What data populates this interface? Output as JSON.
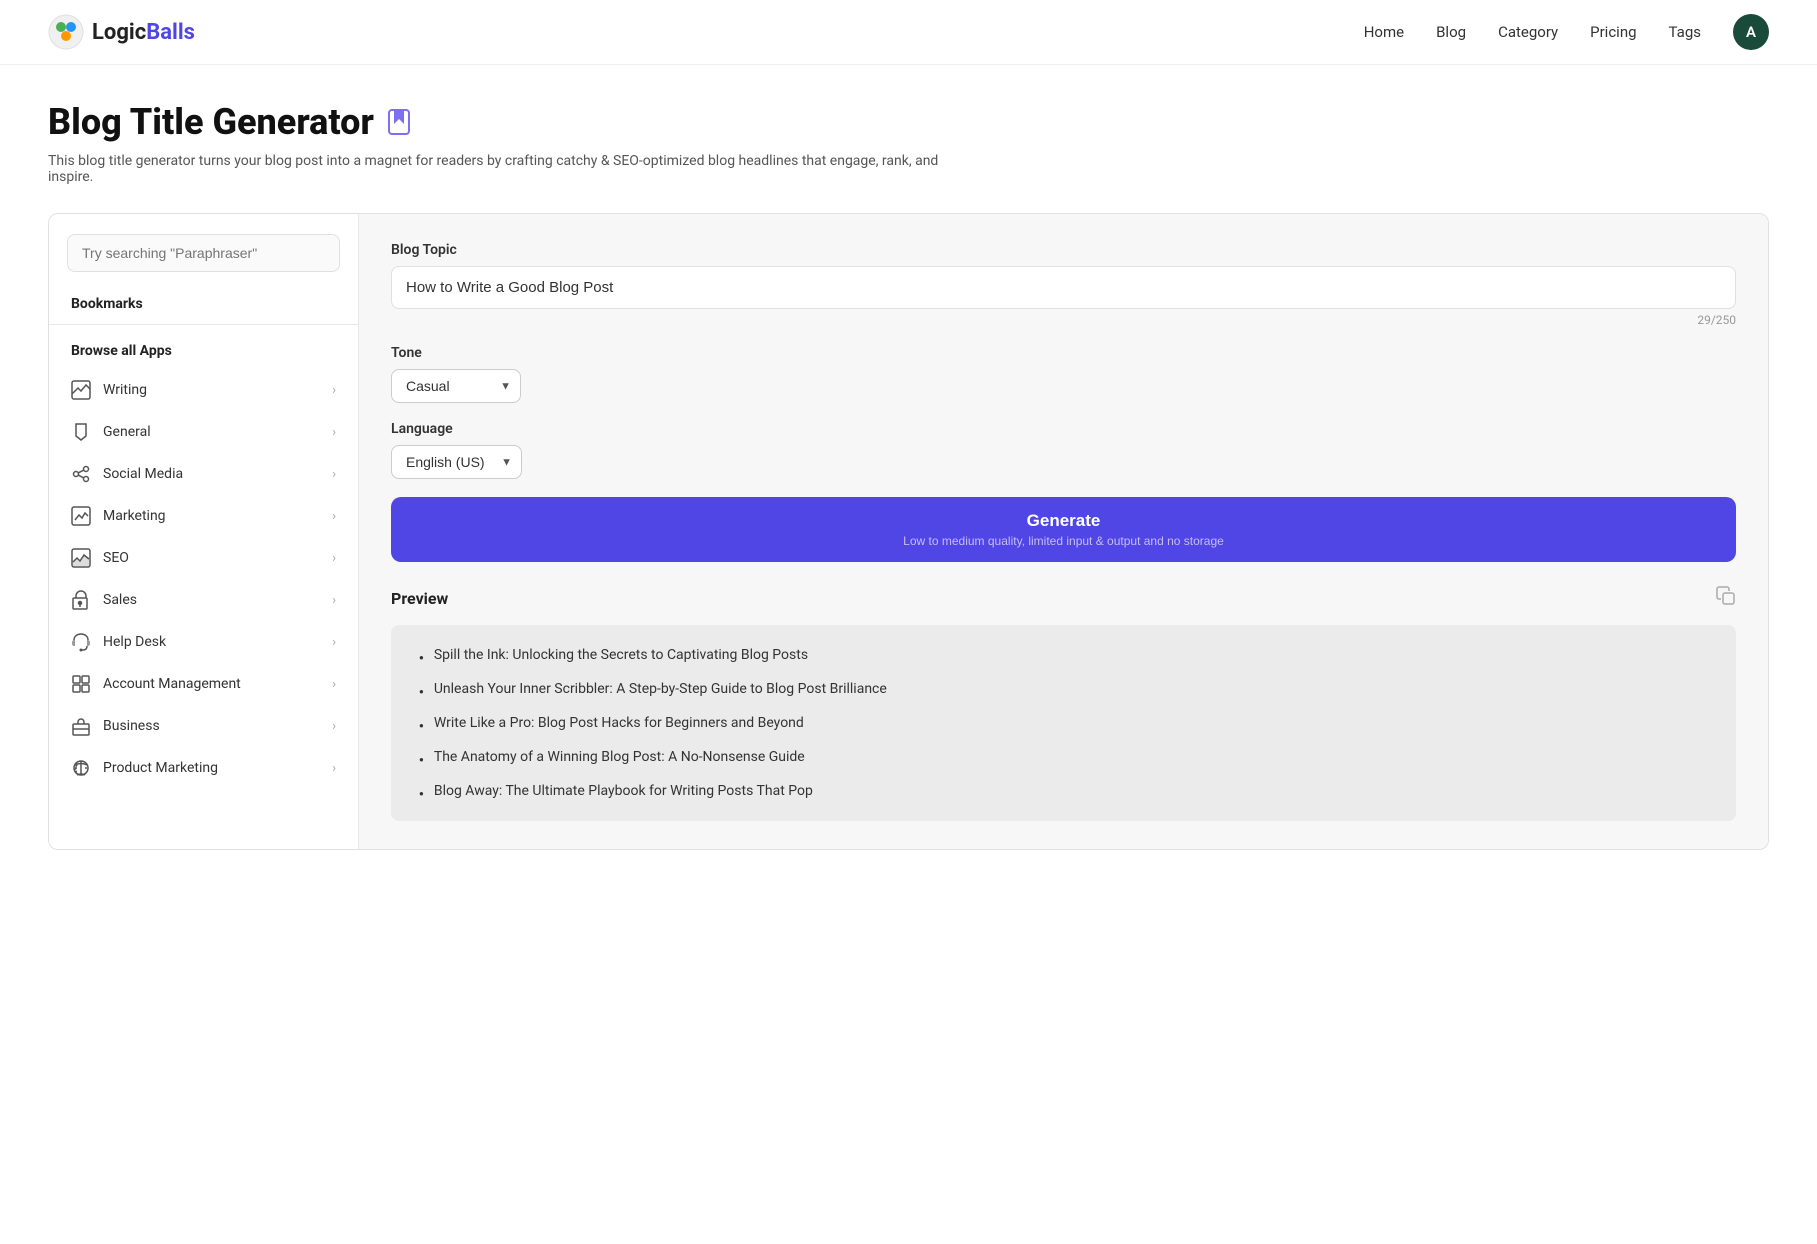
{
  "navbar": {
    "logo_logic": "Logic",
    "logo_balls": "Balls",
    "links": [
      "Home",
      "Blog",
      "Category",
      "Pricing",
      "Tags"
    ],
    "avatar_initial": "A"
  },
  "page": {
    "title": "Blog Title Generator",
    "description": "This blog title generator turns your blog post into a magnet for readers by crafting catchy & SEO-optimized blog headlines that engage, rank, and inspire."
  },
  "search": {
    "placeholder": "Try searching \"Paraphraser\""
  },
  "sidebar": {
    "bookmarks_label": "Bookmarks",
    "browse_label": "Browse all Apps",
    "items": [
      {
        "label": "Writing",
        "icon": "chart-line"
      },
      {
        "label": "General",
        "icon": "pencil"
      },
      {
        "label": "Social Media",
        "icon": "share"
      },
      {
        "label": "Marketing",
        "icon": "chart-bar"
      },
      {
        "label": "SEO",
        "icon": "chart-area"
      },
      {
        "label": "Sales",
        "icon": "cart"
      },
      {
        "label": "Help Desk",
        "icon": "headset"
      },
      {
        "label": "Account Management",
        "icon": "grid"
      },
      {
        "label": "Business",
        "icon": "briefcase"
      },
      {
        "label": "Product Marketing",
        "icon": "megaphone"
      }
    ]
  },
  "form": {
    "blog_topic_label": "Blog Topic",
    "blog_topic_value": "How to Write a Good Blog Post",
    "char_count": "29/250",
    "tone_label": "Tone",
    "tone_value": "Casual",
    "language_label": "Language",
    "language_value": "English (US)",
    "generate_label": "Generate",
    "generate_sub": "Low to medium quality, limited input & output and no storage"
  },
  "preview": {
    "label": "Preview",
    "items": [
      "Spill the Ink: Unlocking the Secrets to Captivating Blog Posts",
      "Unleash Your Inner Scribbler: A Step-by-Step Guide to Blog Post Brilliance",
      "Write Like a Pro: Blog Post Hacks for Beginners and Beyond",
      "The Anatomy of a Winning Blog Post: A No-Nonsense Guide",
      "Blog Away: The Ultimate Playbook for Writing Posts That Pop"
    ]
  }
}
